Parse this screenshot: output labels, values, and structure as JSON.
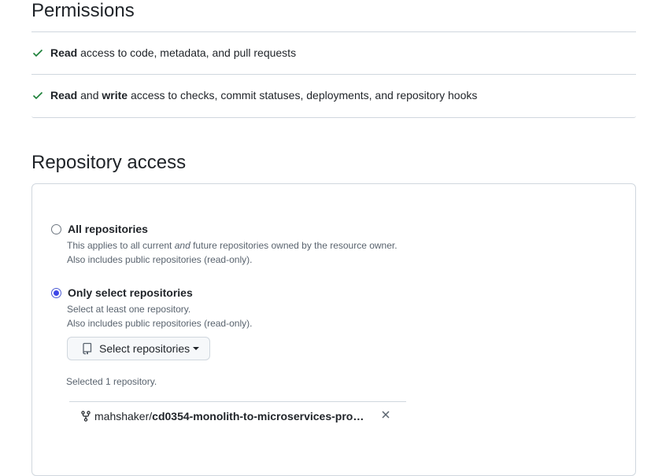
{
  "permissions": {
    "title": "Permissions",
    "items": [
      {
        "strong1": "Read",
        "mid": "",
        "strong2": "",
        "rest": " access to code, metadata, and pull requests"
      },
      {
        "strong1": "Read",
        "mid": " and ",
        "strong2": "write",
        "rest": " access to checks, commit statuses, deployments, and repository hooks"
      }
    ]
  },
  "repo_access": {
    "title": "Repository access",
    "all": {
      "label": "All repositories",
      "note_pre": "This applies to all current ",
      "note_em": "and",
      "note_post": " future repositories owned by the resource owner.",
      "note2": "Also includes public repositories (read-only).",
      "selected": false
    },
    "select": {
      "label": "Only select repositories",
      "note1": "Select at least one repository.",
      "note2": "Also includes public repositories (read-only).",
      "selected": true
    },
    "button_label": "Select repositories",
    "selected_count": "Selected 1 repository.",
    "repo": {
      "owner": "mahshaker/",
      "name": "cd0354-monolith-to-microservices-pro…"
    }
  },
  "colors": {
    "check": "#1a7f37",
    "radio_selected": "#3f48e8",
    "border": "#d0d7de"
  },
  "icons": [
    "check-icon",
    "repo-icon",
    "caret-down-icon",
    "repo-forked-icon",
    "x-icon"
  ]
}
